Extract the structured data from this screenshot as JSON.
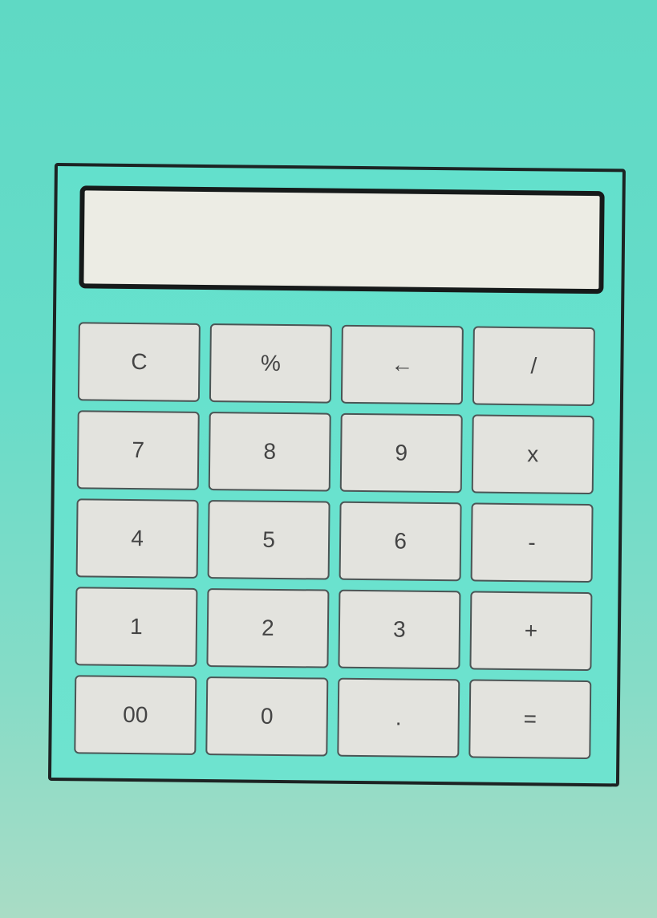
{
  "calculator": {
    "display_value": "",
    "keys": [
      {
        "label": "C",
        "name": "clear-button"
      },
      {
        "label": "%",
        "name": "percent-button"
      },
      {
        "label": "←",
        "name": "backspace-button"
      },
      {
        "label": "/",
        "name": "divide-button"
      },
      {
        "label": "7",
        "name": "digit-7-button"
      },
      {
        "label": "8",
        "name": "digit-8-button"
      },
      {
        "label": "9",
        "name": "digit-9-button"
      },
      {
        "label": "x",
        "name": "multiply-button"
      },
      {
        "label": "4",
        "name": "digit-4-button"
      },
      {
        "label": "5",
        "name": "digit-5-button"
      },
      {
        "label": "6",
        "name": "digit-6-button"
      },
      {
        "label": "-",
        "name": "subtract-button"
      },
      {
        "label": "1",
        "name": "digit-1-button"
      },
      {
        "label": "2",
        "name": "digit-2-button"
      },
      {
        "label": "3",
        "name": "digit-3-button"
      },
      {
        "label": "+",
        "name": "add-button"
      },
      {
        "label": "00",
        "name": "double-zero-button"
      },
      {
        "label": "0",
        "name": "digit-0-button"
      },
      {
        "label": ".",
        "name": "decimal-point-button"
      },
      {
        "label": "=",
        "name": "equals-button"
      }
    ]
  }
}
